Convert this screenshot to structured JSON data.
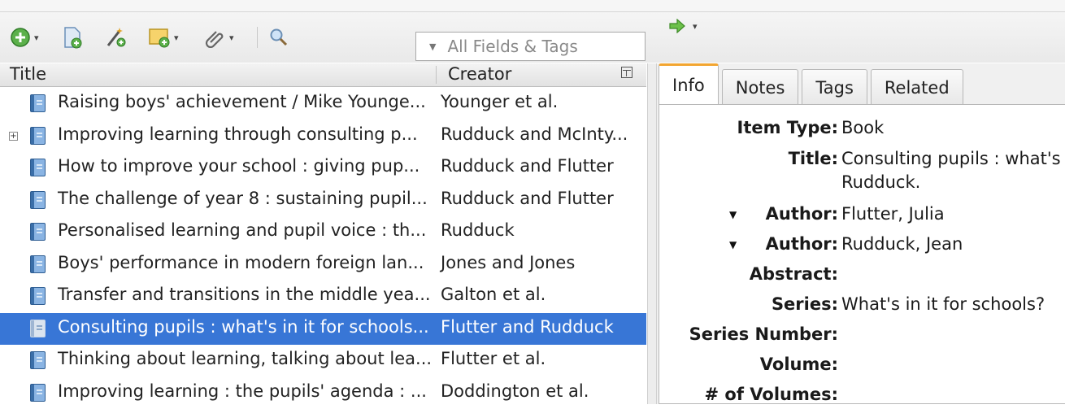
{
  "toolbar": {
    "new_item_icon": "add-circle-icon",
    "new_note_icon": "new-document-icon",
    "add_by_identifier_icon": "magic-wand-icon",
    "new_standalone_note_icon": "note-add-icon",
    "attachment_icon": "paperclip-icon",
    "advanced_search_icon": "magnifier-icon",
    "search_placeholder": "All Fields & Tags",
    "locate_icon": "green-arrow-icon"
  },
  "columns": {
    "title": "Title",
    "creator": "Creator"
  },
  "items": [
    {
      "title": "Raising boys' achievement / Mike Younge...",
      "creator": "Younger et al.",
      "expandable": false,
      "selected": false
    },
    {
      "title": "Improving learning through consulting p...",
      "creator": "Rudduck and McInty...",
      "expandable": true,
      "selected": false
    },
    {
      "title": "How to improve your school : giving pup...",
      "creator": "Rudduck and Flutter",
      "expandable": false,
      "selected": false
    },
    {
      "title": "The challenge of year 8 : sustaining pupil...",
      "creator": "Rudduck and Flutter",
      "expandable": false,
      "selected": false
    },
    {
      "title": "Personalised learning and pupil voice : th...",
      "creator": "Rudduck",
      "expandable": false,
      "selected": false
    },
    {
      "title": "Boys' performance in modern foreign lan...",
      "creator": "Jones and Jones",
      "expandable": false,
      "selected": false
    },
    {
      "title": "Transfer and transitions in the middle yea...",
      "creator": "Galton et al.",
      "expandable": false,
      "selected": false
    },
    {
      "title": "Consulting pupils : what's in it for schools...",
      "creator": "Flutter and Rudduck",
      "expandable": false,
      "selected": true
    },
    {
      "title": "Thinking about learning, talking about lea...",
      "creator": "Flutter et al.",
      "expandable": false,
      "selected": false
    },
    {
      "title": "Improving learning : the pupils' agenda : ...",
      "creator": "Doddington et al.",
      "expandable": false,
      "selected": false
    }
  ],
  "tabs": [
    "Info",
    "Notes",
    "Tags",
    "Related"
  ],
  "info": {
    "item_type_label": "Item Type:",
    "item_type": "Book",
    "title_label": "Title:",
    "title_line1": "Consulting pupils : what's",
    "title_line2": "Rudduck.",
    "author_label": "Author:",
    "author1": "Flutter, Julia",
    "author2": "Rudduck, Jean",
    "abstract_label": "Abstract:",
    "series_label": "Series:",
    "series": "What's in it for schools?",
    "series_number_label": "Series Number:",
    "volume_label": "Volume:",
    "num_volumes_label": "# of Volumes:"
  },
  "colors": {
    "selection": "#3876d6",
    "active_tab_accent": "#f2a531"
  }
}
